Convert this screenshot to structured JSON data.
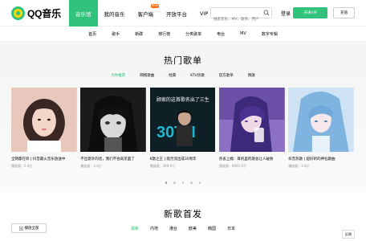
{
  "logo": {
    "text": "QQ音乐"
  },
  "main_nav": [
    {
      "label": "音乐馆",
      "active": true
    },
    {
      "label": "我的音乐"
    },
    {
      "label": "客户端",
      "badge": "NEW"
    },
    {
      "label": "开放平台"
    },
    {
      "label": "VIP"
    }
  ],
  "search": {
    "placeholder": "搜索音乐、MV、歌单、用户"
  },
  "header_actions": {
    "login": "登录",
    "open_vip": "开通VIP",
    "recharge": "充值"
  },
  "sub_nav": [
    "首页",
    "歌手",
    "新碟",
    "排行榜",
    "分类歌单",
    "电台",
    "MV",
    "数字专辑"
  ],
  "hot_playlists": {
    "title": "热门歌单",
    "tabs": [
      "为你推荐",
      "网络歌曲",
      "经典",
      "KTV热歌",
      "官方歌单",
      "情歌"
    ],
    "cards": [
      {
        "title": "全网都在听 | 抖音最火音乐放送中",
        "plays": "播放量：5.9亿"
      },
      {
        "title": "不出意外的话，我们不会再见面了",
        "plays": "播放量：3.4亿"
      },
      {
        "title": "K歌之王 | 能否流出成30周年",
        "plays": "播放量：399.9万"
      },
      {
        "title": "热衷上瘾：耳机里的歌总让人破防",
        "plays": "播放量：9692.9万"
      },
      {
        "title": "抖音热歌 | 超好听的神仙歌曲",
        "plays": "播放量：3.4亿"
      }
    ],
    "cover3_text": {
      "top": "顾家的这首歌名出了三生",
      "big": "30TH"
    }
  },
  "new_songs": {
    "title": "新歌首发",
    "tabs": [
      "最新",
      "内地",
      "港台",
      "欧美",
      "韩国",
      "日本"
    ],
    "play_all": "播放全部"
  },
  "feedback": "反馈",
  "colors": {
    "accent": "#31c27c"
  }
}
